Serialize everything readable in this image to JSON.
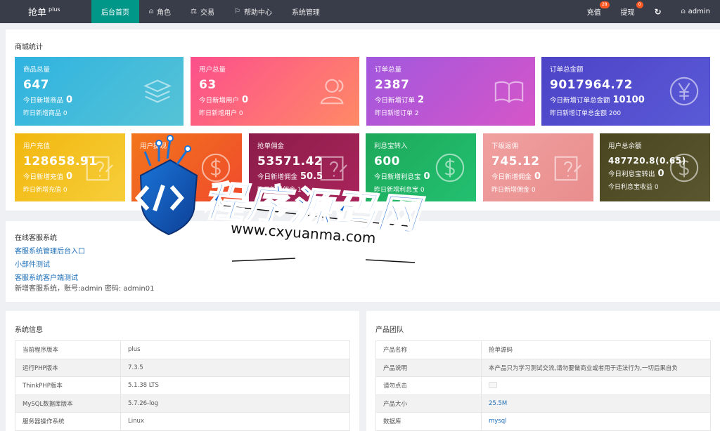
{
  "app": {
    "logo": "抢单",
    "logo_sup": "plus"
  },
  "nav": [
    {
      "label": "后台首页",
      "icon": "",
      "active": true
    },
    {
      "label": "角色",
      "icon": "user-icon"
    },
    {
      "label": "交易",
      "icon": "scale-icon"
    },
    {
      "label": "帮助中心",
      "icon": "flag-icon"
    },
    {
      "label": "系统管理",
      "icon": ""
    }
  ],
  "topright": {
    "recharge": "充值",
    "recharge_badge": "28",
    "withdraw": "提现",
    "withdraw_badge": "0",
    "refresh_icon": "refresh-icon",
    "user": "admin",
    "user_icon": "user-icon"
  },
  "stats": {
    "title": "商城统计",
    "row1": [
      {
        "label": "商品总量",
        "value": "647",
        "sub1": "今日新增商品",
        "sub1v": "0",
        "sub2": "昨日新增商品 0",
        "icon": "layers-icon",
        "color": [
          "#2fb3e0",
          "#56c3d6"
        ]
      },
      {
        "label": "用户总量",
        "value": "63",
        "sub1": "今日新增用户",
        "sub1v": "0",
        "sub2": "昨日新增用户 0",
        "icon": "users-icon",
        "color": [
          "#fc4f8c",
          "#ff8a66"
        ]
      },
      {
        "label": "订单总量",
        "value": "2387",
        "sub1": "今日新增订单",
        "sub1v": "2",
        "sub2": "昨日新增订单 2",
        "icon": "book-icon",
        "color": [
          "#a157de",
          "#d656c8"
        ]
      },
      {
        "label": "订单总金额",
        "value": "9017964.72",
        "sub1": "今日新增订单总金额",
        "sub1v": "10100",
        "sub2": "昨日新增订单总金额 200",
        "icon": "yen-icon",
        "color": [
          "#4d43c7",
          "#5a5ad6"
        ]
      }
    ],
    "row2": [
      {
        "label": "用户充值",
        "value": "128658.91",
        "sub1": "今日新增充值",
        "sub1v": "0",
        "sub2": "昨日新增充值 0",
        "icon": "edit-icon",
        "color": [
          "#f2b70e",
          "#f6ce3a"
        ]
      },
      {
        "label": "用户提现",
        "value": "",
        "sub1": "",
        "sub1v": "",
        "sub2": "",
        "icon": "dollar-icon",
        "color": [
          "#f2761b",
          "#ef4a2c"
        ]
      },
      {
        "label": "抢单佣金",
        "value": "53571.42",
        "sub1": "今日新增佣金",
        "sub1v": "50.5",
        "sub2": "昨日新增佣金 1",
        "icon": "edit-icon",
        "color": [
          "#8c1d4a",
          "#a8245a"
        ]
      },
      {
        "label": "利息宝转入",
        "value": "600",
        "sub1": "今日新增利息宝",
        "sub1v": "0",
        "sub2": "昨日新增利息宝 0",
        "icon": "dollar-icon",
        "color": [
          "#1ea85a",
          "#22c070"
        ]
      },
      {
        "label": "下级返佣",
        "value": "745.12",
        "sub1": "今日新增佣金",
        "sub1v": "0",
        "sub2": "昨日新增佣金 0",
        "icon": "edit-icon",
        "color": [
          "#f0a0a0",
          "#e98d8d"
        ]
      },
      {
        "label": "用户总余额",
        "value": "487720.8(0.65)",
        "sub1": "今日利息宝转出",
        "sub1v": "0",
        "sub2": "今日利息宝收益 0",
        "icon": "dollar-icon",
        "color": [
          "#4a4620",
          "#5a5630"
        ]
      }
    ]
  },
  "service": {
    "title": "在线客服系统",
    "links": [
      "客服系统管理后台入口",
      "小部件测试",
      "客服系统客户端测试"
    ],
    "note": "新增客服系统，账号:admin 密码: admin01"
  },
  "sysinfo": {
    "title": "系统信息",
    "rows": [
      [
        "当前程序版本",
        "plus"
      ],
      [
        "运行PHP版本",
        "7.3.5"
      ],
      [
        "ThinkPHP版本",
        "5.1.38 LTS"
      ],
      [
        "MySQL数据库版本",
        "5.7.26-log"
      ],
      [
        "服务器操作系统",
        "Linux"
      ]
    ]
  },
  "team": {
    "title": "产品团队",
    "rows": [
      [
        "产品名称",
        "抢单源码"
      ],
      [
        "产品说明",
        "本产品只为学习测试交流,请勿要做商业或者用于违法行为,一切后果自负"
      ],
      [
        "请勿点击",
        ""
      ],
      [
        "产品大小",
        "25.5M"
      ],
      [
        "数据库",
        "mysql"
      ]
    ]
  },
  "watermark": {
    "title": "程序源码网",
    "url": "www.cxyuanma.com"
  }
}
